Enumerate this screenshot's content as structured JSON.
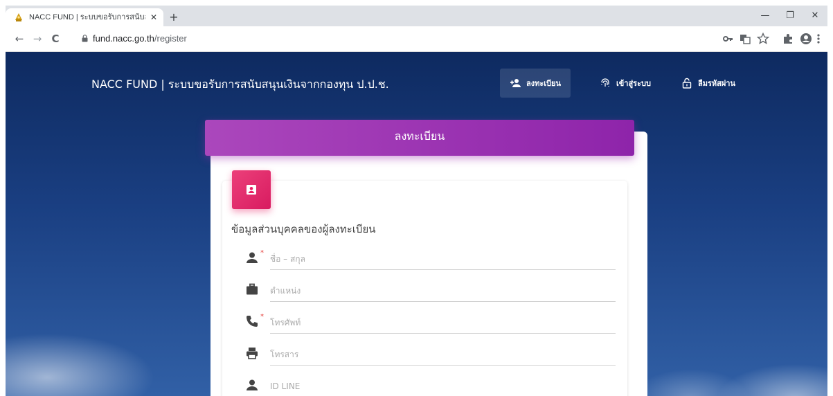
{
  "browser": {
    "tab_title": "NACC FUND | ระบบขอรับการสนับสนุนเงิน",
    "tab_close": "✕",
    "new_tab": "+",
    "window_controls": {
      "minimize": "—",
      "restore": "❐",
      "close": "✕"
    },
    "nav": {
      "back": "←",
      "forward": "→",
      "reload": "C"
    },
    "url": {
      "domain": "fund.nacc.go.th",
      "path": "/register"
    },
    "icons": [
      "key-icon",
      "translate-icon",
      "star-icon",
      "extensions-icon",
      "profile-icon",
      "menu-icon"
    ]
  },
  "site": {
    "brand": "NACC FUND | ระบบขอรับการสนับสนุนเงินจากกองทุน ป.ป.ช.",
    "nav_items": [
      {
        "label": "ลงทะเบียน",
        "icon": "person-add-icon",
        "active": true
      },
      {
        "label": "เข้าสู่ระบบ",
        "icon": "fingerprint-icon",
        "active": false
      },
      {
        "label": "ลืมรหัสผ่าน",
        "icon": "lock-open-icon",
        "active": false
      }
    ]
  },
  "form": {
    "header": "ลงทะเบียน",
    "section_title": "ข้อมูลส่วนบุคคลของผู้ลงทะเบียน",
    "required_mark": "*",
    "fields": [
      {
        "placeholder": "ชื่อ – สกุล",
        "icon": "person-icon",
        "required": true,
        "value": ""
      },
      {
        "placeholder": "ตำแหน่ง",
        "icon": "briefcase-icon",
        "required": false,
        "value": ""
      },
      {
        "placeholder": "โทรศัพท์",
        "icon": "phone-icon",
        "required": true,
        "value": ""
      },
      {
        "placeholder": "โทรสาร",
        "icon": "printer-icon",
        "required": false,
        "value": ""
      },
      {
        "placeholder": "ID LINE",
        "icon": "person-icon",
        "required": false,
        "value": ""
      }
    ]
  },
  "colors": {
    "header_gradient_start": "#ab47bc",
    "header_gradient_end": "#8e24aa",
    "badge": "#e91e63",
    "required": "#e53935",
    "background": "#1a3f82"
  }
}
